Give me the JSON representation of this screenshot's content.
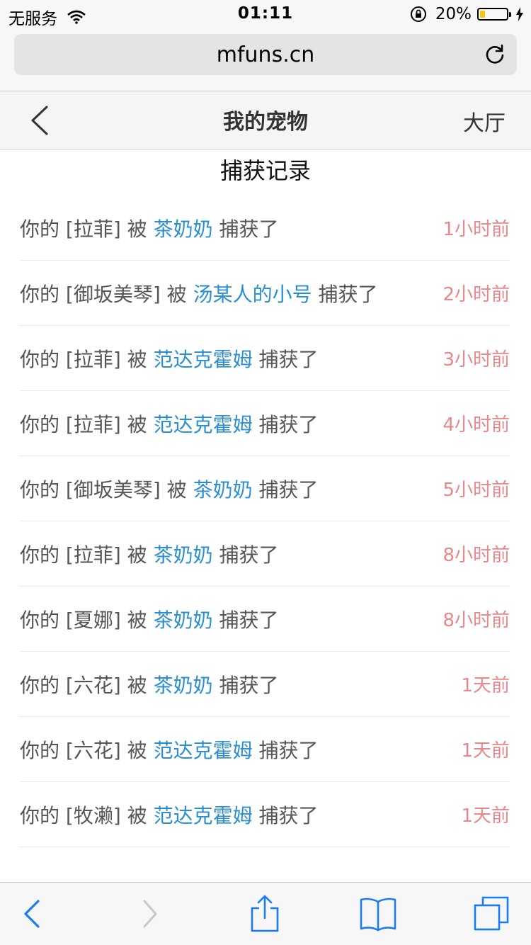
{
  "status_bar": {
    "carrier": "无服务",
    "time": "01:11",
    "battery": "20%",
    "battery_level": 0.2
  },
  "url_bar": {
    "url": "mfuns.cn"
  },
  "page_header": {
    "title": "我的宠物",
    "right_link": "大厅"
  },
  "section_title": "捕获记录",
  "records": [
    {
      "prefix": "你的 [拉菲] 被 ",
      "catcher": "茶奶奶",
      "suffix": " 捕获了",
      "time": "1小时前"
    },
    {
      "prefix": "你的 [御坂美琴] 被 ",
      "catcher": "汤某人的小号",
      "suffix": " 捕获了",
      "time": "2小时前"
    },
    {
      "prefix": "你的 [拉菲] 被 ",
      "catcher": "范达克霍姆",
      "suffix": " 捕获了",
      "time": "3小时前"
    },
    {
      "prefix": "你的 [拉菲] 被 ",
      "catcher": "范达克霍姆",
      "suffix": " 捕获了",
      "time": "4小时前"
    },
    {
      "prefix": "你的 [御坂美琴] 被 ",
      "catcher": "茶奶奶",
      "suffix": " 捕获了",
      "time": "5小时前"
    },
    {
      "prefix": "你的 [拉菲] 被 ",
      "catcher": "茶奶奶",
      "suffix": " 捕获了",
      "time": "8小时前"
    },
    {
      "prefix": "你的 [夏娜] 被 ",
      "catcher": "茶奶奶",
      "suffix": " 捕获了",
      "time": "8小时前"
    },
    {
      "prefix": "你的 [六花] 被 ",
      "catcher": "茶奶奶",
      "suffix": " 捕获了",
      "time": "1天前"
    },
    {
      "prefix": "你的 [六花] 被 ",
      "catcher": "范达克霍姆",
      "suffix": " 捕获了",
      "time": "1天前"
    },
    {
      "prefix": "你的 [牧濑] 被 ",
      "catcher": "范达克霍姆",
      "suffix": " 捕获了",
      "time": "1天前"
    }
  ],
  "toolbar": {
    "icons": [
      "back-icon",
      "forward-icon",
      "share-icon",
      "bookmarks-icon",
      "tabs-icon"
    ]
  },
  "colors": {
    "catcher_link": "#2a8fd1",
    "time_text": "#e8888a",
    "browser_accent": "#1a7cf5",
    "battery_fill": "#f5c518"
  }
}
